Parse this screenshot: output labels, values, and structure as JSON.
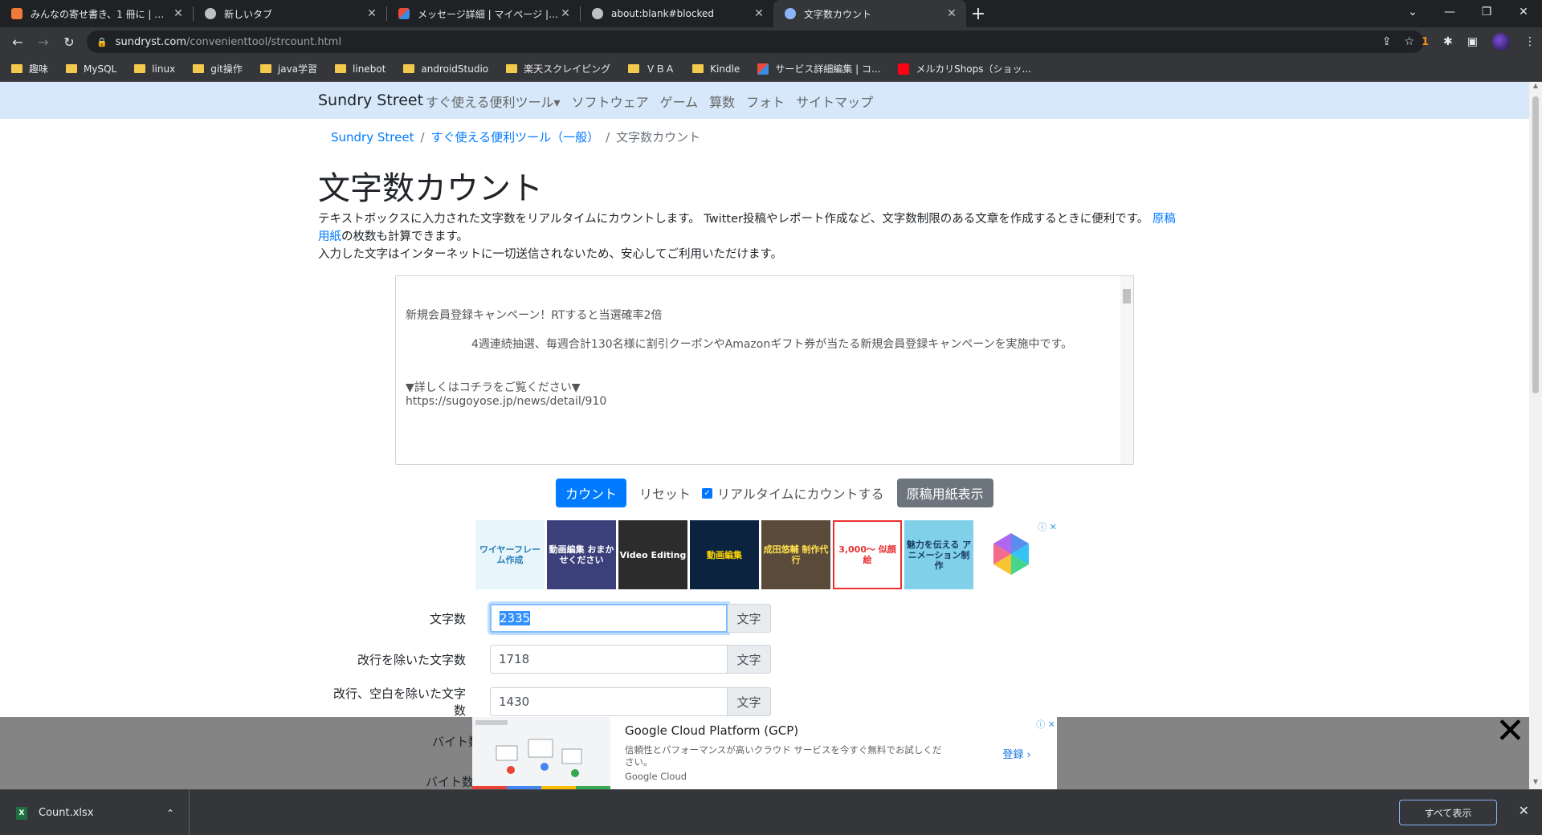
{
  "browser": {
    "tabs": [
      {
        "title": "みんなの寄せ書き、1 冊に | スゴヨセ",
        "favicon_color": "#f07a3c",
        "active": false
      },
      {
        "title": "新しいタブ",
        "favicon_color": "#bdc1c6",
        "active": false
      },
      {
        "title": "メッセージ詳細 | マイページ | ココナラ",
        "favicon_color": "#e8eaed",
        "active": false
      },
      {
        "title": "about:blank#blocked",
        "favicon_color": "#bdc1c6",
        "active": false
      },
      {
        "title": "文字数カウント",
        "favicon_color": "#8ab4f8",
        "active": true
      }
    ],
    "url_host": "sundryst.com",
    "url_path": "/convenienttool/strcount.html",
    "extension_badge": "1",
    "bookmarks": [
      {
        "label": "趣味",
        "type": "folder"
      },
      {
        "label": "MySQL",
        "type": "folder"
      },
      {
        "label": "linux",
        "type": "folder"
      },
      {
        "label": "git操作",
        "type": "folder"
      },
      {
        "label": "java学習",
        "type": "folder"
      },
      {
        "label": "linebot",
        "type": "folder"
      },
      {
        "label": "androidStudio",
        "type": "folder"
      },
      {
        "label": "楽天スクレイピング",
        "type": "folder"
      },
      {
        "label": "ＶＢＡ",
        "type": "folder"
      },
      {
        "label": "Kindle",
        "type": "folder"
      },
      {
        "label": "サービス詳細編集 | コ...",
        "type": "site"
      },
      {
        "label": "メルカリShops（ショッ...",
        "type": "site"
      }
    ]
  },
  "site": {
    "brand": "Sundry Street",
    "nav": [
      "すぐ使える便利ツール▾",
      "ソフトウェア",
      "ゲーム",
      "算数",
      "フォト",
      "サイトマップ"
    ],
    "breadcrumb": [
      "Sundry Street",
      "すぐ使える便利ツール（一般）",
      "文字数カウント"
    ],
    "title": "文字数カウント",
    "desc_1": "テキストボックスに入力された文字数をリアルタイムにカウントします。 Twitter投稿やレポート作成など、文字数制限のある文章を作成するときに便利です。",
    "desc_link_1": "原稿",
    "desc_link_2": "用紙",
    "desc_2": "の枚数も計算できます。",
    "desc_3": "入力した文字はインターネットに一切送信されないため、安心してご利用いただけます。",
    "textarea_lines": [
      "新規会員登録キャンペーン！RTすると当選確率2倍",
      "4週連続抽選、毎週合計130名様に割引クーポンやAmazonギフト券が当たる新規会員登録キャンペーンを実施中です。",
      "▼詳しくはコチラをご覧ください▼",
      "https://sugoyose.jp/news/detail/910"
    ],
    "buttons": {
      "count": "カウント",
      "reset": "リセット",
      "realtime": "リアルタイムにカウントする",
      "manuscript": "原稿用紙表示"
    },
    "ads": [
      {
        "text": "ワイヤーフレーム作成",
        "bg": "#e8f6fb"
      },
      {
        "text": "動画編集 おまかせください",
        "bg": "#3b3f7a"
      },
      {
        "text": "Video Editing",
        "bg": "#2c2c2c"
      },
      {
        "text": "動画編集",
        "bg": "#0c2340"
      },
      {
        "text": "成田悠輔 制作代行",
        "bg": "#5a4a3a"
      },
      {
        "text": "3,000〜 似顔絵",
        "bg": "#e83030"
      },
      {
        "text": "魅力を伝える アニメーション制作",
        "bg": "#7fd0e8"
      }
    ],
    "results": [
      {
        "label": "文字数",
        "value": "2335",
        "unit": "文字"
      },
      {
        "label": "改行を除いた文字数",
        "value": "1718",
        "unit": "文字"
      },
      {
        "label": "改行、空白を除いた文字数",
        "value": "1430",
        "unit": "文字"
      }
    ],
    "byte_labels": [
      "バイト数",
      "バイト数"
    ],
    "bottom_ad": {
      "title": "Google Cloud Platform (GCP)",
      "body": "信頼性とパフォーマンスが高いクラウド サービスを今すぐ無料でお試しください。",
      "source": "Google Cloud",
      "cta": "登録 ›"
    }
  },
  "download": {
    "file": "Count.xlsx",
    "show_all": "すべて表示"
  }
}
